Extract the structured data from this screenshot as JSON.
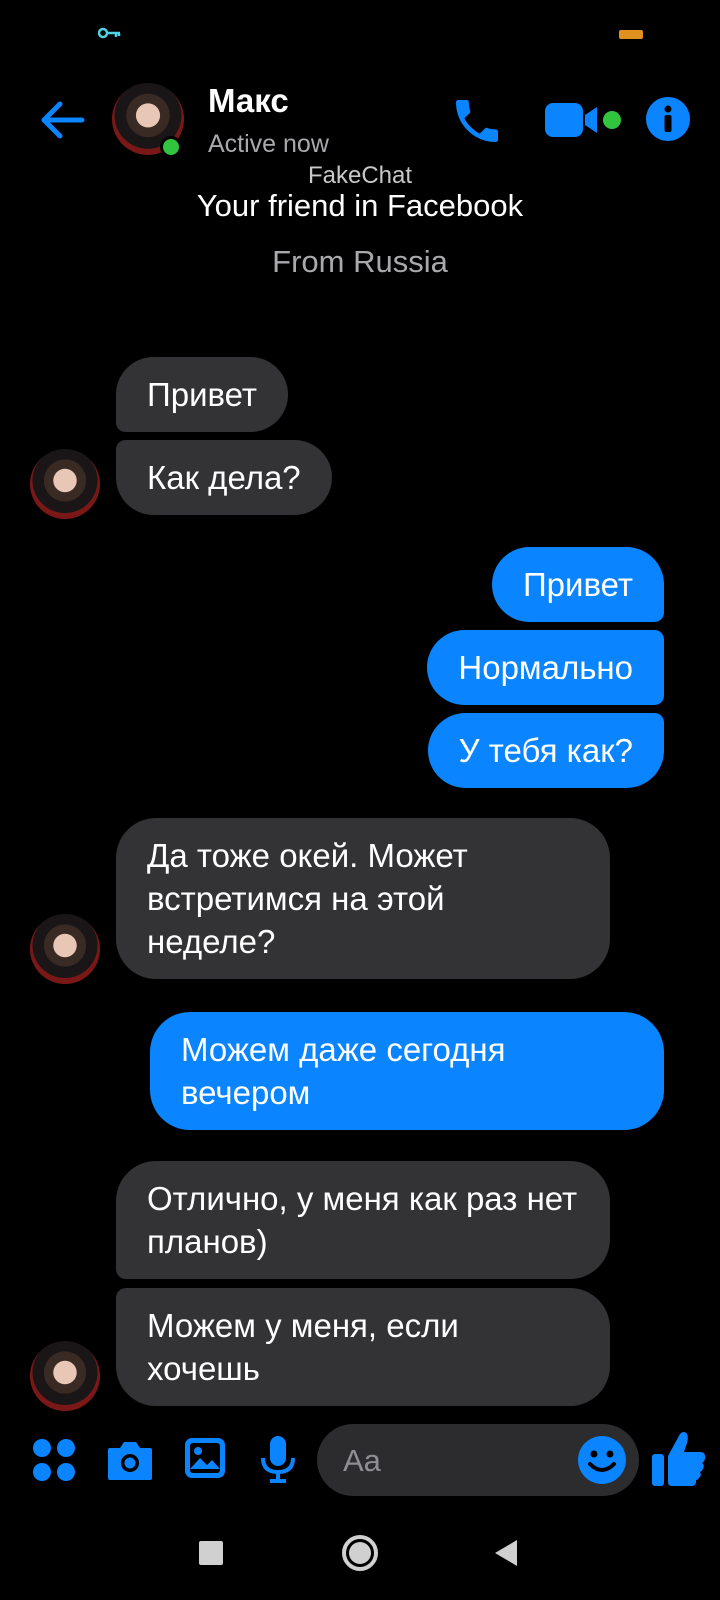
{
  "header": {
    "contact_name": "Макс",
    "status": "Active now"
  },
  "profile": {
    "watermark": "FakeChat",
    "friend_line": "Your friend in Facebook",
    "location": "From Russia"
  },
  "messages": [
    {
      "from": "contact",
      "text": "Привет"
    },
    {
      "from": "contact",
      "text": "Как дела?"
    },
    {
      "from": "me",
      "text": "Привет"
    },
    {
      "from": "me",
      "text": "Нормально"
    },
    {
      "from": "me",
      "text": "У тебя как?"
    },
    {
      "from": "contact",
      "text": "Да тоже окей. Может встретимся на этой неделе?"
    },
    {
      "from": "me",
      "text": "Можем даже сегодня вечером"
    },
    {
      "from": "contact",
      "text": "Отлично, у меня как раз нет планов)"
    },
    {
      "from": "contact",
      "text": "Можем у меня, если хочешь"
    }
  ],
  "composer": {
    "placeholder": "Aa"
  },
  "colors": {
    "accent": "#0a84ff",
    "incoming_bubble": "#333335",
    "online": "#31c53f",
    "background": "#000000"
  },
  "icons": [
    "key-icon",
    "battery-icon",
    "back-arrow-icon",
    "phone-icon",
    "video-camera-icon",
    "info-icon",
    "apps-grid-icon",
    "camera-icon",
    "gallery-icon",
    "microphone-icon",
    "emoji-icon",
    "thumbs-up-icon",
    "nav-recents-icon",
    "nav-home-icon",
    "nav-back-icon"
  ]
}
